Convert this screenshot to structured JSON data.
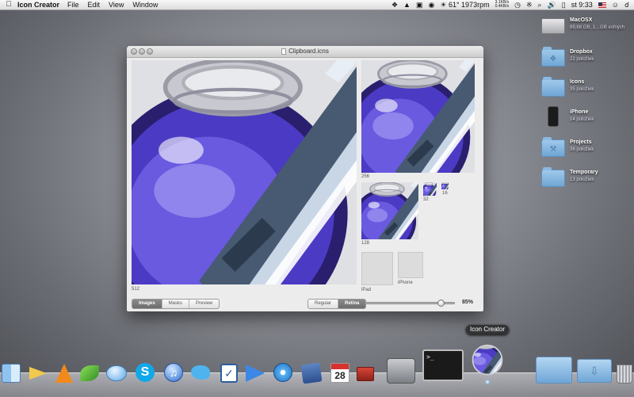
{
  "menubar": {
    "app_name": "Icon Creator",
    "menus": [
      "File",
      "Edit",
      "View",
      "Window"
    ],
    "status": {
      "weather": "61° 1973rpm",
      "net_up": "3.1KB/s",
      "net_down": "0.4KB/s",
      "clock": "st 9:33"
    }
  },
  "window": {
    "title": "Clipboard.icns",
    "size_labels": {
      "s512": "512",
      "s256": "256",
      "s128": "128",
      "s32": "32",
      "s16": "16",
      "ipad": "iPad",
      "iphone": "iPhone"
    },
    "view_tabs": [
      "Images",
      "Masks",
      "Preview"
    ],
    "view_selected": "Images",
    "mode_tabs": [
      "Regular",
      "Retina"
    ],
    "mode_selected": "Retina",
    "zoom": {
      "value": 0.85,
      "label": "85%"
    }
  },
  "desktop_icons": [
    {
      "name": "MacOSX",
      "subtitle": "89,68 GB, 1…GB voľných",
      "icon": "hard-drive-icon"
    },
    {
      "name": "Dropbox",
      "subtitle": "22 položiek",
      "icon": "dropbox-folder-icon"
    },
    {
      "name": "Icons",
      "subtitle": "35 položiek",
      "icon": "folder-icon"
    },
    {
      "name": "iPhone",
      "subtitle": "14 položiek",
      "icon": "iphone-icon"
    },
    {
      "name": "Projects",
      "subtitle": "36 položiek",
      "icon": "tools-folder-icon"
    },
    {
      "name": "Temporary",
      "subtitle": "13 položiek",
      "icon": "folder-icon"
    }
  ],
  "dock": {
    "tooltip": "Icon Creator",
    "calendar_day": "28",
    "apps": [
      "finder-icon",
      "megaphone-icon",
      "vlc-icon",
      "leaf-icon",
      "messages-icon",
      "skype-icon",
      "itunes-icon",
      "twitter-bird-icon",
      "tasks-icon",
      "send-arrow-icon",
      "safari-icon",
      "xcode-icon",
      "calendar-icon",
      "toolbox-icon",
      "system-preferences-icon",
      "terminal-icon",
      "icon-creator-icon",
      "documents-folder-icon",
      "downloads-folder-icon",
      "trash-icon"
    ]
  },
  "colors": {
    "ink": "#4b3bc4",
    "pen": "#5a6e86",
    "selected_tab": "#7a7a7a"
  }
}
